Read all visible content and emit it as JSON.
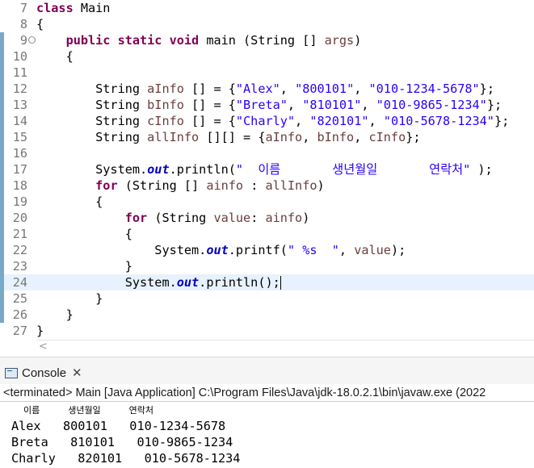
{
  "editor": {
    "lines": [
      {
        "num": "7",
        "parts": [
          [
            "kw",
            "class"
          ],
          [
            "t",
            " Main"
          ]
        ]
      },
      {
        "num": "8",
        "parts": [
          [
            "t",
            "{"
          ]
        ]
      },
      {
        "num": "9",
        "fold": "⊖",
        "parts": [
          [
            "t",
            "    "
          ],
          [
            "kw",
            "public static void"
          ],
          [
            "t",
            " main (String [] "
          ],
          [
            "var",
            "args"
          ],
          [
            "t",
            ")"
          ]
        ]
      },
      {
        "num": "10",
        "parts": [
          [
            "t",
            "    {"
          ]
        ]
      },
      {
        "num": "11",
        "parts": []
      },
      {
        "num": "12",
        "parts": [
          [
            "t",
            "        String "
          ],
          [
            "var",
            "aInfo"
          ],
          [
            "t",
            " [] = {"
          ],
          [
            "str",
            "\"Alex\""
          ],
          [
            "t",
            ", "
          ],
          [
            "str",
            "\"800101\""
          ],
          [
            "t",
            ", "
          ],
          [
            "str",
            "\"010-1234-5678\""
          ],
          [
            "t",
            "};"
          ]
        ]
      },
      {
        "num": "13",
        "parts": [
          [
            "t",
            "        String "
          ],
          [
            "var",
            "bInfo"
          ],
          [
            "t",
            " [] = {"
          ],
          [
            "str",
            "\"Breta\""
          ],
          [
            "t",
            ", "
          ],
          [
            "str",
            "\"810101\""
          ],
          [
            "t",
            ", "
          ],
          [
            "str",
            "\"010-9865-1234\""
          ],
          [
            "t",
            "};"
          ]
        ]
      },
      {
        "num": "14",
        "parts": [
          [
            "t",
            "        String "
          ],
          [
            "var",
            "cInfo"
          ],
          [
            "t",
            " [] = {"
          ],
          [
            "str",
            "\"Charly\""
          ],
          [
            "t",
            ", "
          ],
          [
            "str",
            "\"820101\""
          ],
          [
            "t",
            ", "
          ],
          [
            "str",
            "\"010-5678-1234\""
          ],
          [
            "t",
            "};"
          ]
        ]
      },
      {
        "num": "15",
        "parts": [
          [
            "t",
            "        String "
          ],
          [
            "var",
            "allInfo"
          ],
          [
            "t",
            " [][] = {"
          ],
          [
            "var",
            "aInfo"
          ],
          [
            "t",
            ", "
          ],
          [
            "var",
            "bInfo"
          ],
          [
            "t",
            ", "
          ],
          [
            "var",
            "cInfo"
          ],
          [
            "t",
            "};"
          ]
        ]
      },
      {
        "num": "16",
        "parts": []
      },
      {
        "num": "17",
        "parts": [
          [
            "t",
            "        System."
          ],
          [
            "fld",
            "out"
          ],
          [
            "t",
            ".println("
          ],
          [
            "str",
            "\"  이름       생년월일       연락처\""
          ],
          [
            "t",
            " );"
          ]
        ]
      },
      {
        "num": "18",
        "parts": [
          [
            "t",
            "        "
          ],
          [
            "kw",
            "for"
          ],
          [
            "t",
            " (String [] "
          ],
          [
            "var",
            "ainfo"
          ],
          [
            "t",
            " : "
          ],
          [
            "var",
            "allInfo"
          ],
          [
            "t",
            ")"
          ]
        ]
      },
      {
        "num": "19",
        "parts": [
          [
            "t",
            "        {"
          ]
        ]
      },
      {
        "num": "20",
        "parts": [
          [
            "t",
            "            "
          ],
          [
            "kw",
            "for"
          ],
          [
            "t",
            " (String "
          ],
          [
            "var",
            "value"
          ],
          [
            "t",
            ": "
          ],
          [
            "var",
            "ainfo"
          ],
          [
            "t",
            ")"
          ]
        ]
      },
      {
        "num": "21",
        "parts": [
          [
            "t",
            "            {"
          ]
        ]
      },
      {
        "num": "22",
        "parts": [
          [
            "t",
            "                System."
          ],
          [
            "fld",
            "out"
          ],
          [
            "t",
            ".printf("
          ],
          [
            "str",
            "\" %s  \""
          ],
          [
            "t",
            ", "
          ],
          [
            "var",
            "value"
          ],
          [
            "t",
            ");"
          ]
        ]
      },
      {
        "num": "23",
        "parts": [
          [
            "t",
            "            }"
          ]
        ]
      },
      {
        "num": "24",
        "current": true,
        "parts": [
          [
            "t",
            "            System."
          ],
          [
            "fld",
            "out"
          ],
          [
            "t",
            ".println();"
          ],
          [
            "caret",
            ""
          ]
        ]
      },
      {
        "num": "25",
        "parts": [
          [
            "t",
            "        }"
          ]
        ]
      },
      {
        "num": "26",
        "parts": [
          [
            "t",
            "    }"
          ]
        ]
      },
      {
        "num": "27",
        "parts": [
          [
            "t",
            "}"
          ]
        ]
      }
    ],
    "hscroll_arrow": "<"
  },
  "console": {
    "tab_label": "Console",
    "close_glyph": "✕",
    "status": "<terminated> Main [Java Application] C:\\Program Files\\Java\\jdk-18.0.2.1\\bin\\javaw.exe  (2022",
    "output": [
      {
        "text": "  이름          생년월일          연락처",
        "header": true
      },
      {
        "text": "Alex   800101   010-1234-5678"
      },
      {
        "text": "Breta   810101   010-9865-1234"
      },
      {
        "text": "Charly   820101   010-5678-1234"
      }
    ]
  },
  "colors": {
    "keyword": "#7f0055",
    "string": "#2a00ff",
    "field": "#0000c0",
    "variable": "#6a3e3e",
    "current_line": "#e8f2fe"
  }
}
